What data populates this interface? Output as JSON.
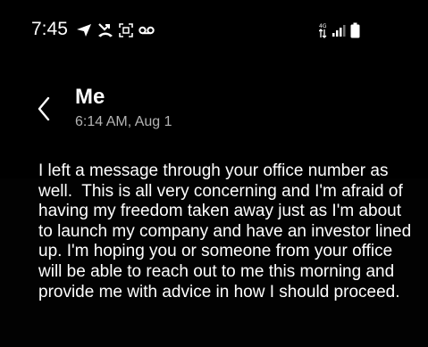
{
  "status_bar": {
    "time": "7:45",
    "left_icons": [
      "navigation-icon",
      "missed-call-icon",
      "screenshot-icon",
      "voicemail-icon"
    ],
    "right_icons": [
      "data-4g-icon",
      "signal-icon",
      "battery-icon"
    ]
  },
  "header": {
    "back_icon": "chevron-left-icon",
    "sender_name": "Me",
    "timestamp": "6:14 AM, Aug 1"
  },
  "message": {
    "body": "I left a message through your office number as well.  This is all very concerning and I'm afraid of having my freedom taken away just as I'm about to launch my company and have an investor lined up. I'm hoping you or someone from your office will be able to reach out to me this morning and provide me with advice in how I should proceed."
  },
  "colors": {
    "background": "#000000",
    "text": "#ffffff",
    "secondary_text": "#b3b3b3"
  }
}
